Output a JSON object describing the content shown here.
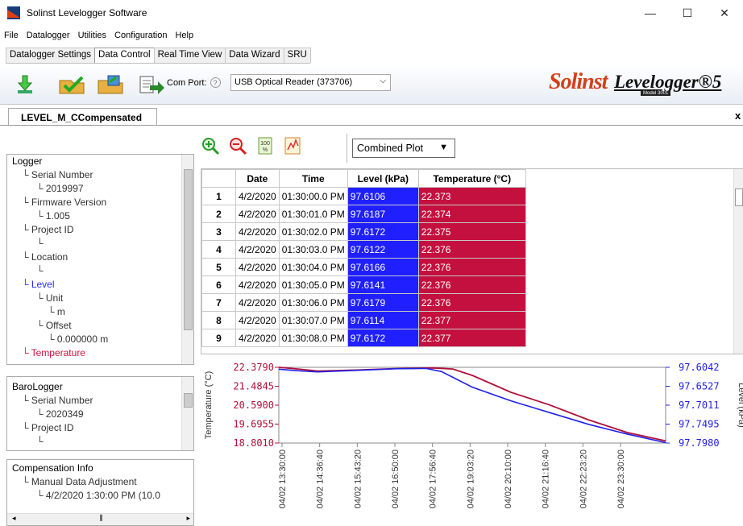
{
  "window": {
    "title": "Solinst Levelogger Software",
    "min": "—",
    "max": "☐",
    "close": "✕"
  },
  "menu": [
    "File",
    "Datalogger",
    "Utilities",
    "Configuration",
    "Help"
  ],
  "tabs": [
    {
      "label": "Datalogger Settings"
    },
    {
      "label": "Data Control",
      "active": true
    },
    {
      "label": "Real Time View"
    },
    {
      "label": "Data Wizard"
    },
    {
      "label": "SRU"
    }
  ],
  "toolbar": {
    "com_port_label": "Com Port:",
    "help": "?",
    "com_port_value": "USB Optical Reader (373706)",
    "brand": "Solinst",
    "product": "Levelogger®5",
    "model": "Model 3001"
  },
  "document_tab": "LEVEL_M_CCompensated",
  "logger_tree": [
    {
      "level": 0,
      "text": "Logger"
    },
    {
      "level": 1,
      "text": "Serial Number"
    },
    {
      "level": 2,
      "text": "2019997"
    },
    {
      "level": 1,
      "text": "Firmware Version"
    },
    {
      "level": 2,
      "text": "1.005"
    },
    {
      "level": 1,
      "text": "Project ID"
    },
    {
      "level": 2,
      "text": ""
    },
    {
      "level": 1,
      "text": "Location"
    },
    {
      "level": 2,
      "text": ""
    },
    {
      "level": 1,
      "text": "Level",
      "color": "#2a2aff"
    },
    {
      "level": 2,
      "text": "Unit"
    },
    {
      "level": 3,
      "text": "m"
    },
    {
      "level": 2,
      "text": "Offset"
    },
    {
      "level": 3,
      "text": "0.000000 m"
    },
    {
      "level": 1,
      "text": "Temperature",
      "color": "#d01040"
    }
  ],
  "baro_tree": [
    {
      "level": 0,
      "text": "BaroLogger"
    },
    {
      "level": 1,
      "text": "Serial Number"
    },
    {
      "level": 2,
      "text": "2020349"
    },
    {
      "level": 1,
      "text": "Project ID"
    },
    {
      "level": 2,
      "text": ""
    }
  ],
  "comp_tree": [
    {
      "level": 0,
      "text": "Compensation Info"
    },
    {
      "level": 1,
      "text": "Manual Data Adjustment"
    },
    {
      "level": 2,
      "text": "4/2/2020 1:30:00 PM (10.0"
    }
  ],
  "plot_mode": "Combined Plot",
  "table": {
    "headers": [
      "",
      "Date",
      "Time",
      "Level (kPa)",
      "Temperature (°C)"
    ],
    "rows": [
      [
        "1",
        "4/2/2020",
        "01:30:00.0 PM",
        "97.6106",
        "22.373"
      ],
      [
        "2",
        "4/2/2020",
        "01:30:01.0 PM",
        "97.6187",
        "22.374"
      ],
      [
        "3",
        "4/2/2020",
        "01:30:02.0 PM",
        "97.6172",
        "22.375"
      ],
      [
        "4",
        "4/2/2020",
        "01:30:03.0 PM",
        "97.6122",
        "22.376"
      ],
      [
        "5",
        "4/2/2020",
        "01:30:04.0 PM",
        "97.6166",
        "22.376"
      ],
      [
        "6",
        "4/2/2020",
        "01:30:05.0 PM",
        "97.6141",
        "22.376"
      ],
      [
        "7",
        "4/2/2020",
        "01:30:06.0 PM",
        "97.6179",
        "22.376"
      ],
      [
        "8",
        "4/2/2020",
        "01:30:07.0 PM",
        "97.6114",
        "22.377"
      ],
      [
        "9",
        "4/2/2020",
        "01:30:08.0 PM",
        "97.6172",
        "22.377"
      ]
    ]
  },
  "chart_data": {
    "type": "line",
    "ylabel_left": "Temperature (°C)",
    "ylabel_right": "Level (kPa)",
    "left_ticks": [
      "22.3790",
      "21.4845",
      "20.5900",
      "19.6955",
      "18.8010"
    ],
    "right_ticks": [
      "97.6042",
      "97.6527",
      "97.7011",
      "97.7495",
      "97.7980"
    ],
    "x_ticks": [
      "04/02 13:30:00",
      "04/02 14:36:40",
      "04/02 15:43:20",
      "04/02 16:50:00",
      "04/02 17:56:40",
      "04/02 19:03:20",
      "04/02 20:10:00",
      "04/02 21:16:40",
      "04/02 22:23:20",
      "04/02 23:30:00"
    ],
    "series": [
      {
        "name": "Temperature (°C)",
        "color": "#b0103a",
        "axis": "left",
        "x": [
          0,
          0.05,
          0.1,
          0.2,
          0.3,
          0.4,
          0.45,
          0.5,
          0.55,
          0.6,
          0.7,
          0.8,
          0.9,
          1.0
        ],
        "y": [
          22.379,
          22.3,
          22.2,
          22.25,
          22.32,
          22.35,
          22.3,
          22.0,
          21.6,
          21.2,
          20.6,
          19.9,
          19.3,
          18.9
        ]
      },
      {
        "name": "Level (kPa)",
        "color": "#2020e8",
        "axis": "right",
        "x": [
          0,
          0.05,
          0.1,
          0.2,
          0.3,
          0.38,
          0.42,
          0.5,
          0.6,
          0.7,
          0.8,
          0.9,
          1.0
        ],
        "y": [
          97.609,
          97.613,
          97.616,
          97.612,
          97.608,
          97.607,
          97.615,
          97.655,
          97.69,
          97.72,
          97.75,
          97.775,
          97.797
        ]
      }
    ]
  }
}
